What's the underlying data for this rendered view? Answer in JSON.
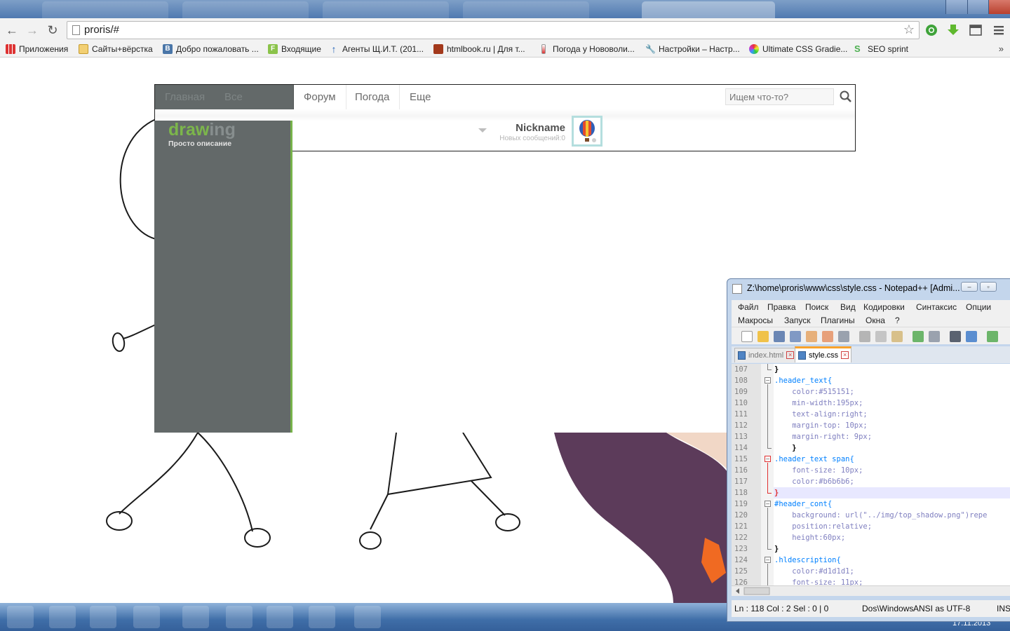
{
  "browser": {
    "url": "proris/#",
    "bookmarks": [
      {
        "label": "Приложения",
        "icon": "apps-grid-icon"
      },
      {
        "label": "Сайты+вёрстка",
        "icon": "folder-icon"
      },
      {
        "label": "Добро пожаловать ...",
        "icon": "vk-icon"
      },
      {
        "label": "Входящие",
        "icon": "mail-icon"
      },
      {
        "label": "Агенты Щ.И.Т. (201...",
        "icon": "arrow-up-icon"
      },
      {
        "label": "htmlbook.ru | Для т...",
        "icon": "htmlbook-icon"
      },
      {
        "label": "Погода у Нововоли...",
        "icon": "thermometer-icon"
      },
      {
        "label": "Настройки – Настр...",
        "icon": "wrench-icon"
      },
      {
        "label": "Ultimate CSS Gradie...",
        "icon": "gradient-icon"
      },
      {
        "label": "SEO sprint",
        "icon": "seo-sprint-icon"
      }
    ],
    "bookmarks_more": "»"
  },
  "site": {
    "nav": [
      "Главная",
      "Все рисунки",
      "Форум",
      "Погода",
      "Еще"
    ],
    "search_placeholder": "Ищем что-то?",
    "logo_part1": "draw",
    "logo_part2": "ing",
    "logo_subtitle": "Просто описание",
    "nickname": "Nickname",
    "messages": "Новых сообщений:0",
    "colors": {
      "accent": "#77b34b",
      "sidebar": "#636969",
      "nickname": "#515151",
      "messages": "#b6b6b6"
    }
  },
  "notepad": {
    "title": "Z:\\home\\proris\\www\\css\\style.css - Notepad++ [Admi...",
    "menu_row1": [
      "Файл",
      "Правка",
      "Поиск",
      "Вид",
      "Кодировки",
      "Синтаксис",
      "Опции"
    ],
    "menu_row2": [
      "Макросы",
      "Запуск",
      "Плагины",
      "Окна",
      "?"
    ],
    "tabs": [
      {
        "label": "index.html",
        "active": false
      },
      {
        "label": "style.css",
        "active": true
      }
    ],
    "lines": [
      {
        "n": "107",
        "text": "}"
      },
      {
        "n": "108",
        "text": ".header_text{"
      },
      {
        "n": "109",
        "text": "    color:#515151;"
      },
      {
        "n": "110",
        "text": "    min-width:195px;"
      },
      {
        "n": "111",
        "text": "    text-align:right;"
      },
      {
        "n": "112",
        "text": "    margin-top: 10px;"
      },
      {
        "n": "113",
        "text": "    margin-right: 9px;"
      },
      {
        "n": "114",
        "text": "    }"
      },
      {
        "n": "115",
        "text": ".header_text span{"
      },
      {
        "n": "116",
        "text": "    font-size: 10px;"
      },
      {
        "n": "117",
        "text": "    color:#b6b6b6;"
      },
      {
        "n": "118",
        "text": "}"
      },
      {
        "n": "119",
        "text": "#header_cont{"
      },
      {
        "n": "120",
        "text": "    background: url(\"../img/top_shadow.png\")repe"
      },
      {
        "n": "121",
        "text": "    position:relative;"
      },
      {
        "n": "122",
        "text": "    height:60px;"
      },
      {
        "n": "123",
        "text": "}"
      },
      {
        "n": "124",
        "text": ".hldescription{"
      },
      {
        "n": "125",
        "text": "    color:#d1d1d1;"
      },
      {
        "n": "126",
        "text": "    font-size: 11px;"
      }
    ],
    "status": {
      "position": "Ln : 118    Col : 2    Sel : 0 | 0",
      "eol": "Dos\\Windows",
      "encoding": "ANSI as UTF-8",
      "mode": "INS"
    }
  },
  "taskbar": {
    "date": "17.11.2013"
  }
}
